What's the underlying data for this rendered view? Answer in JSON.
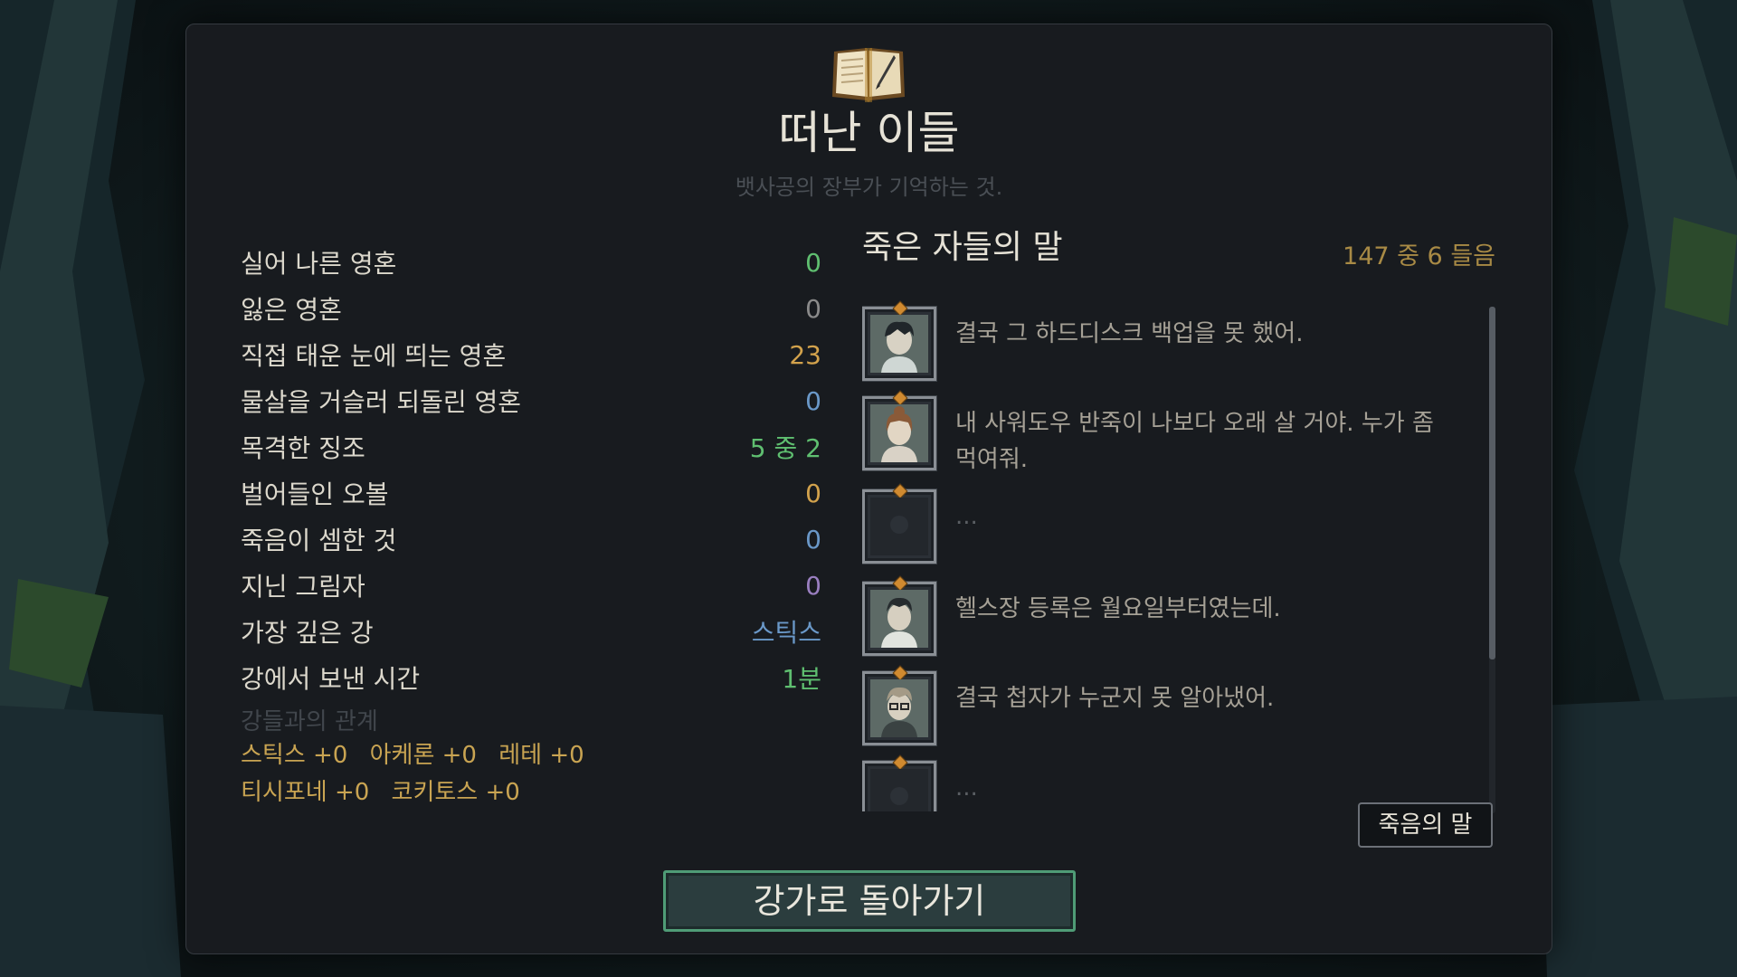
{
  "header": {
    "title": "떠난 이들",
    "subtitle": "뱃사공의 장부가 기억하는 것.",
    "icon": "open-book-quill-icon"
  },
  "stats": [
    {
      "label": "실어 나른 영혼",
      "value": "0",
      "color": "#5fbf70"
    },
    {
      "label": "잃은 영혼",
      "value": "0",
      "color": "#8a8a8a"
    },
    {
      "label": "직접 태운 눈에 띄는 영혼",
      "value": "23",
      "color": "#d2a24c"
    },
    {
      "label": "물살을 거슬러 되돌린 영혼",
      "value": "0",
      "color": "#6a98c8"
    },
    {
      "label": "목격한 징조",
      "value": "5 중 2",
      "color": "#5fbf70"
    },
    {
      "label": "벌어들인 오볼",
      "value": "0",
      "color": "#d2a24c"
    },
    {
      "label": "죽음이 셈한 것",
      "value": "0",
      "color": "#6a98c8"
    },
    {
      "label": "지닌 그림자",
      "value": "0",
      "color": "#9a7fc0"
    },
    {
      "label": "가장 깊은 강",
      "value": "스틱스",
      "color": "#6a98c8"
    },
    {
      "label": "강에서 보낸 시간",
      "value": "1분",
      "color": "#5fbf70"
    }
  ],
  "relations": {
    "heading": "강들과의 관계",
    "items": [
      "스틱스 +0",
      "아케론 +0",
      "레테 +0",
      "티시포네 +0",
      "코키토스 +0"
    ]
  },
  "last_words": {
    "title": "죽은 자들의 말",
    "count": "147 중 6 들음",
    "entries": [
      {
        "text": "결국 그 하드디스크 백업을 못 했어.",
        "portrait": "dark-haired-man-portrait",
        "locked": false
      },
      {
        "text": "내 사워도우 반죽이 나보다 오래 살 거야. 누가 좀 먹여줘.",
        "portrait": "brown-haired-woman-portrait",
        "locked": false
      },
      {
        "text": "...",
        "portrait": "locked-portrait",
        "locked": true
      },
      {
        "text": "헬스장 등록은 월요일부터였는데.",
        "portrait": "young-man-portrait",
        "locked": false
      },
      {
        "text": "결국 첩자가 누군지 못 알아냈어.",
        "portrait": "glasses-man-portrait",
        "locked": false
      },
      {
        "text": "...",
        "portrait": "locked-portrait",
        "locked": true
      }
    ]
  },
  "buttons": {
    "death_words": "죽음의 말",
    "return": "강가로 돌아가기"
  },
  "colors": {
    "panel": "#181b1f",
    "accent_green": "#4f9c76",
    "gold": "#c9a452"
  }
}
